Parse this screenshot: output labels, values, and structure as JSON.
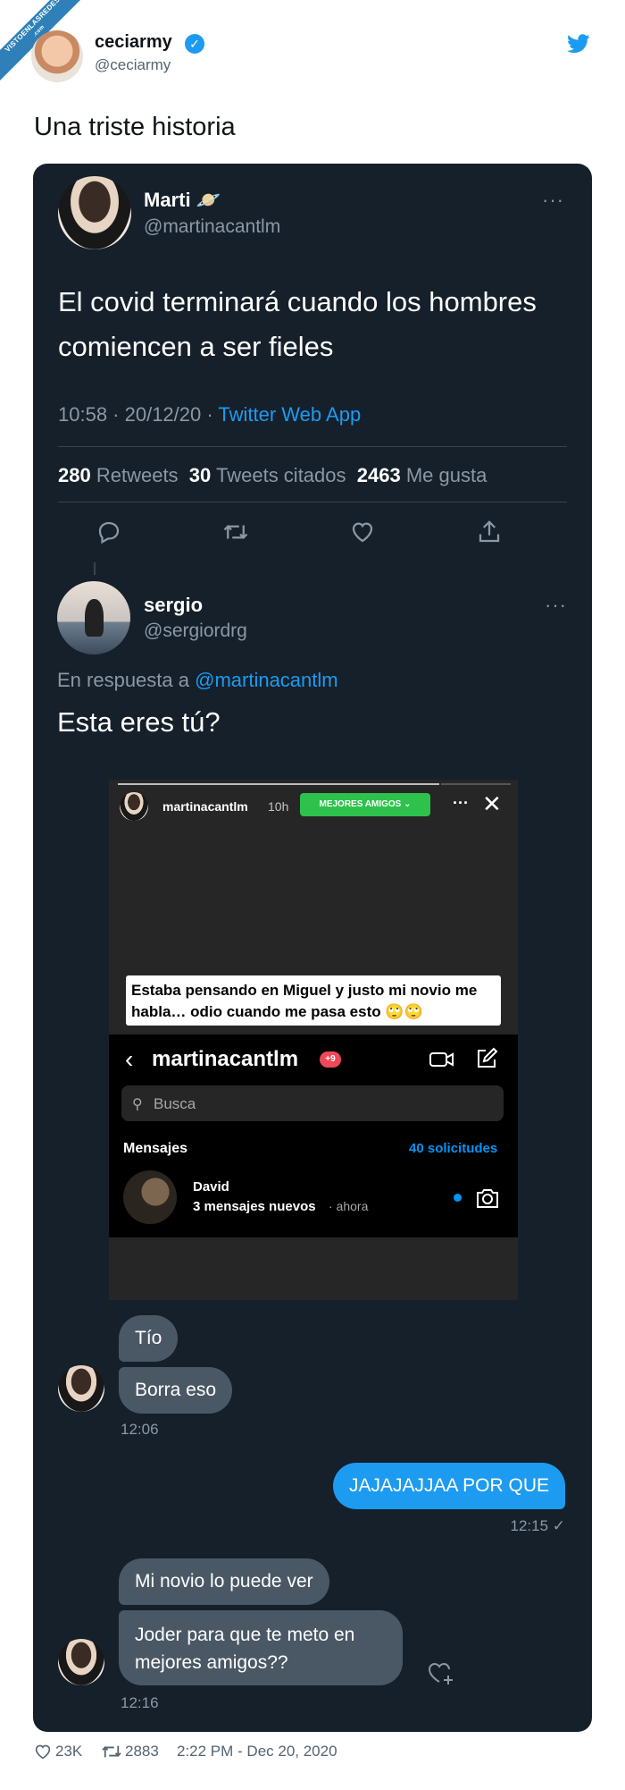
{
  "watermark": {
    "line1": "VISTOENLASREDES",
    "line2": ".com"
  },
  "tweet": {
    "name": "ceciarmy",
    "handle": "@ceciarmy",
    "text": "Una triste historia",
    "likes": "23K",
    "retweets": "2883",
    "datetime": "2:22 PM - Dec 20, 2020",
    "icons": {
      "verified": "verified-badge-icon",
      "brand": "twitter-bird-icon",
      "like": "heart-icon",
      "retweet": "retweet-icon"
    }
  },
  "screenshot": {
    "original_tweet": {
      "name": "Marti",
      "emoji": "🪐",
      "handle": "@martinacantlm",
      "text": "El covid terminará cuando los hombres comiencen a ser fieles",
      "time": "10:58 · 20/12/20 ·",
      "source": "Twitter Web App",
      "retweets_count": "280",
      "retweets_label": "Retweets",
      "quotes_count": "30",
      "quotes_label": "Tweets citados",
      "likes_count": "2463",
      "likes_label": "Me gusta",
      "more": "···"
    },
    "reply": {
      "name": "sergio",
      "handle": "@sergiordrg",
      "replying_prefix": "En respuesta a",
      "replying_to": "@martinacantlm",
      "text": "Esta eres tú?",
      "more": "···"
    },
    "story": {
      "username": "martinacantlm",
      "time": "10h",
      "best_friends": "MEJORES AMIGOS ⌄",
      "more": "···",
      "close": "✕",
      "caption": "Estaba pensando en Miguel y justo mi novio me habla… odio cuando me pasa esto 🙄🙄",
      "dm": {
        "back": "‹",
        "username": "martinacantlm",
        "badge": "+9",
        "search_placeholder": "Busca",
        "search_icon": "⚲",
        "messages_label": "Mensajes",
        "requests": "40 solicitudes",
        "contact_name": "David",
        "contact_preview": "3 mensajes nuevos",
        "contact_time": "· ahora"
      }
    },
    "chat": [
      {
        "text": "Tío"
      },
      {
        "text": "Borra eso"
      },
      {
        "time": "12:06"
      },
      {
        "text": "JAJAJAJJAA POR QUE"
      },
      {
        "time": "12:15 ✓"
      },
      {
        "text": "Mi novio lo puede ver"
      },
      {
        "text": "Joder para que te meto en mejores amigos??"
      },
      {
        "time": "12:16"
      }
    ]
  }
}
